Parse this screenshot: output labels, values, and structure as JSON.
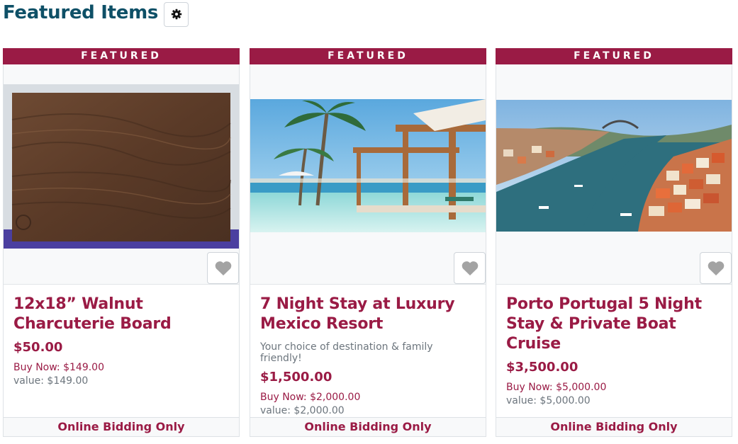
{
  "page": {
    "title": "Featured Items"
  },
  "icons": {
    "settings": "gear-icon",
    "favorite": "heart-icon"
  },
  "colors": {
    "brand": "#9a1b45",
    "title": "#0e5067"
  },
  "cards": [
    {
      "badge": "FEATURED",
      "title": "12x18” Walnut Charcuterie Board",
      "description": "",
      "bid": "$50.00",
      "buy_now": "Buy Now: $149.00",
      "value": "value: $149.00",
      "footer": "Online Bidding Only"
    },
    {
      "badge": "FEATURED",
      "title": "7 Night Stay at Luxury Mexico Resort",
      "description": "Your choice of destination & family friendly!",
      "bid": "$1,500.00",
      "buy_now": "Buy Now: $2,000.00",
      "value": "value: $2,000.00",
      "footer": "Online Bidding Only"
    },
    {
      "badge": "FEATURED",
      "title": "Porto Portugal 5 Night Stay & Private Boat Cruise",
      "description": "",
      "bid": "$3,500.00",
      "buy_now": "Buy Now: $5,000.00",
      "value": "value: $5,000.00",
      "footer": "Online Bidding Only"
    }
  ]
}
